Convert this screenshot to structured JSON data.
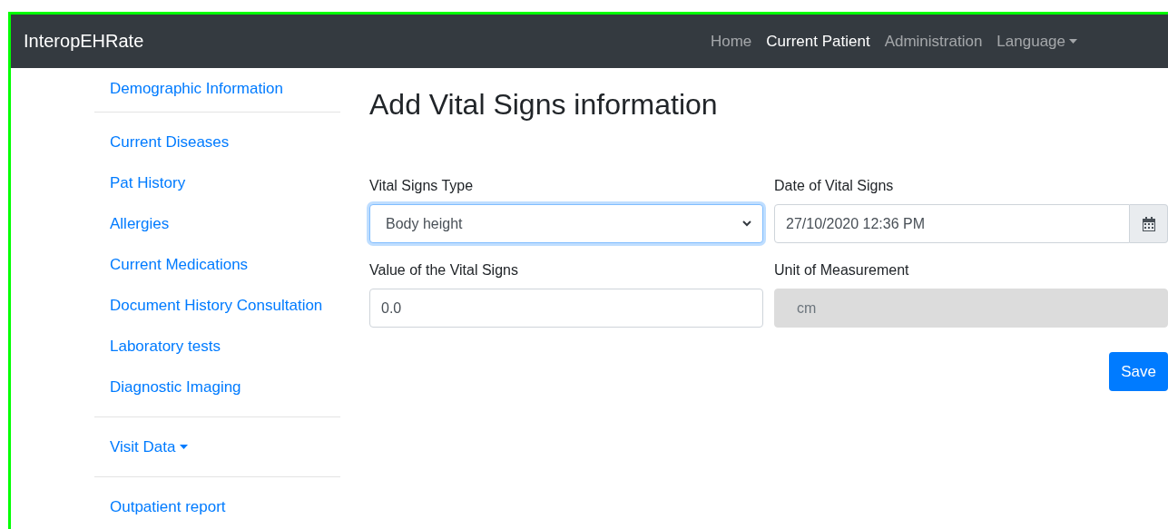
{
  "navbar": {
    "brand": "InteropEHRate",
    "items": [
      {
        "label": "Home",
        "selected": false,
        "dropdown": false
      },
      {
        "label": "Current Patient",
        "selected": true,
        "dropdown": false
      },
      {
        "label": "Administration",
        "selected": false,
        "dropdown": false
      },
      {
        "label": "Language",
        "selected": false,
        "dropdown": true
      }
    ]
  },
  "sidebar": {
    "groups": [
      {
        "items": [
          {
            "label": "Demographic Information",
            "dropdown": false
          }
        ]
      },
      {
        "items": [
          {
            "label": "Current Diseases",
            "dropdown": false
          },
          {
            "label": "Pat History",
            "dropdown": false
          },
          {
            "label": "Allergies",
            "dropdown": false
          },
          {
            "label": "Current Medications",
            "dropdown": false
          },
          {
            "label": "Document History Consultation",
            "dropdown": false
          },
          {
            "label": "Laboratory tests",
            "dropdown": false
          },
          {
            "label": "Diagnostic Imaging",
            "dropdown": false
          }
        ]
      },
      {
        "items": [
          {
            "label": "Visit Data",
            "dropdown": true
          }
        ]
      },
      {
        "items": [
          {
            "label": "Outpatient report",
            "dropdown": false
          }
        ]
      }
    ]
  },
  "form": {
    "title": "Add Vital Signs information",
    "fields": [
      {
        "label": "Vital Signs Type",
        "kind": "select",
        "value": "Body height",
        "focused": true,
        "disabled": false
      },
      {
        "label": "Date of Vital Signs",
        "kind": "datetime",
        "value": "27/10/2020 12:36 PM",
        "focused": false,
        "disabled": false
      },
      {
        "label": "Value of the Vital Signs",
        "kind": "text",
        "value": "0.0",
        "focused": false,
        "disabled": false
      },
      {
        "label": "Unit of Measurement",
        "kind": "text",
        "value": "cm",
        "focused": false,
        "disabled": true
      }
    ],
    "button": "Save"
  }
}
